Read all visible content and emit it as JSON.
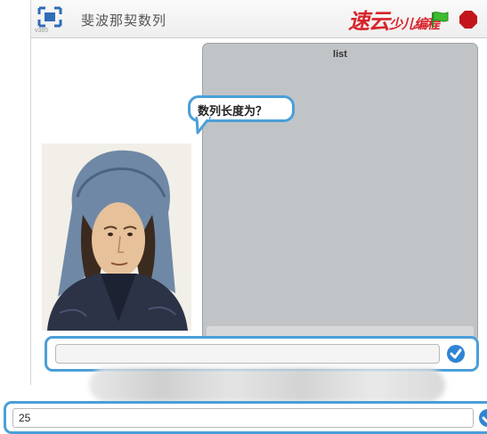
{
  "titlebar": {
    "version": "v385",
    "project_title": "斐波那契数列",
    "watermark_main": "速云",
    "watermark_small": "少儿编程"
  },
  "stage": {
    "list_title": "list",
    "speech_text": "数列长度为？"
  },
  "answer": {
    "value": "25"
  },
  "colors": {
    "accent": "#4a9fd8",
    "list_bg": "#c1c4c7",
    "watermark": "#d8232a",
    "stop": "#c2161c",
    "flag": "#3dbb2f"
  }
}
